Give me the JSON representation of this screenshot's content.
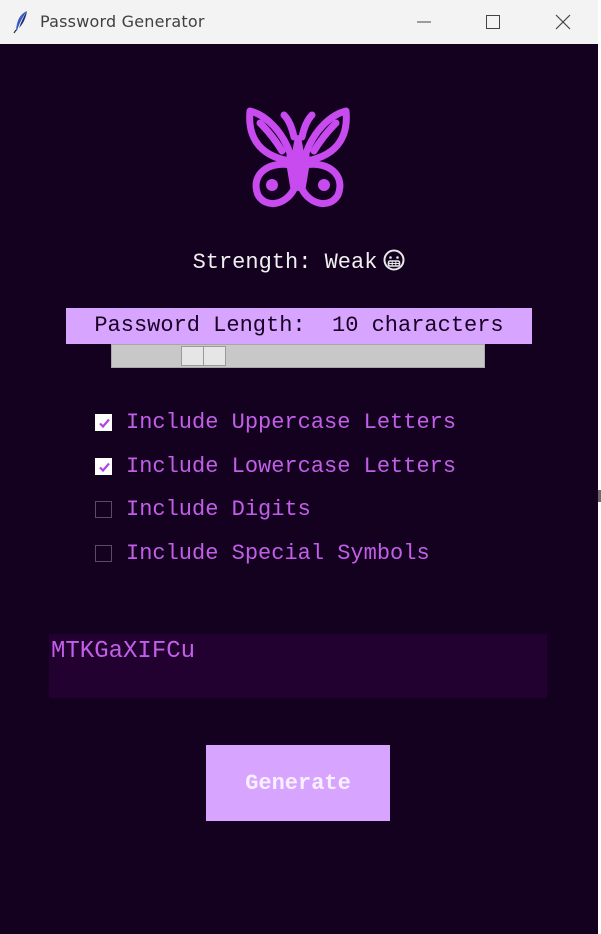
{
  "window": {
    "title": "Password Generator",
    "app_icon": "feather-icon",
    "controls": [
      "minimize-icon",
      "maximize-icon",
      "close-icon"
    ]
  },
  "colors": {
    "background": "#14001f",
    "accent": "#d7a4ff",
    "logo": "#c74bee",
    "option_text": "#c25fe9",
    "output_bg": "#22002f"
  },
  "logo": {
    "icon": "butterfly-icon"
  },
  "strength": {
    "label": "Strength: Weak",
    "emoji": "grimacing-face-icon"
  },
  "length": {
    "label": "Password Length:  10 characters",
    "value": 10,
    "slider_fraction": 0.21
  },
  "options": [
    {
      "label": "Include Uppercase Letters",
      "checked": true
    },
    {
      "label": "Include Lowercase Letters",
      "checked": true
    },
    {
      "label": "Include Digits",
      "checked": false
    },
    {
      "label": "Include Special Symbols",
      "checked": false
    }
  ],
  "output": {
    "password": "MTKGaXIFCu"
  },
  "generate_button": {
    "label": "Generate"
  }
}
